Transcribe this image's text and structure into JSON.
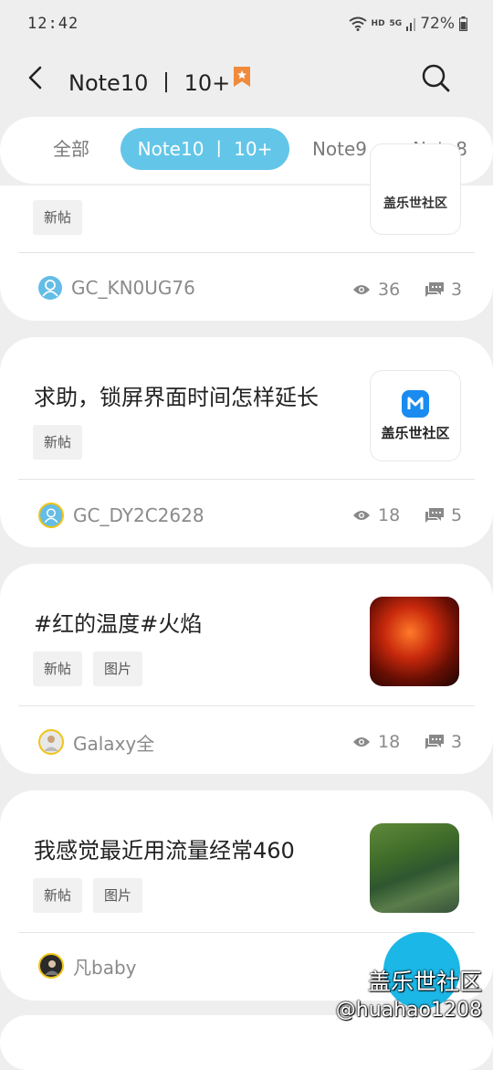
{
  "status": {
    "time": "12:42",
    "network": "HD",
    "signal": "5G",
    "battery": "72%"
  },
  "appbar": {
    "title": "Note10 丨 10+"
  },
  "tabs": [
    {
      "label": "全部"
    },
    {
      "label": "Note10 丨 10+"
    },
    {
      "label": "Note9"
    },
    {
      "label": "Note8"
    }
  ],
  "posts": [
    {
      "title": "",
      "tags": [
        "新帖"
      ],
      "author": "GC_KN0UG76",
      "views": "36",
      "comments": "3",
      "thumb_text": "盖乐世社区"
    },
    {
      "title": "求助，锁屏界面时间怎样延长",
      "tags": [
        "新帖"
      ],
      "author": "GC_DY2C2628",
      "views": "18",
      "comments": "5",
      "thumb_text": "盖乐世社区"
    },
    {
      "title": "#红的温度#火焰",
      "tags": [
        "新帖",
        "图片"
      ],
      "author": "Galaxy全",
      "views": "18",
      "comments": "3"
    },
    {
      "title": "我感觉最近用流量经常460",
      "tags": [
        "新帖",
        "图片"
      ],
      "author": "凡baby"
    }
  ],
  "watermark": {
    "line1": "盖乐世社区",
    "line2": "@huahao1208"
  },
  "colors": {
    "accent": "#63c6e8",
    "fab": "#1bb7e6",
    "bookmark": "#f08a3c"
  }
}
